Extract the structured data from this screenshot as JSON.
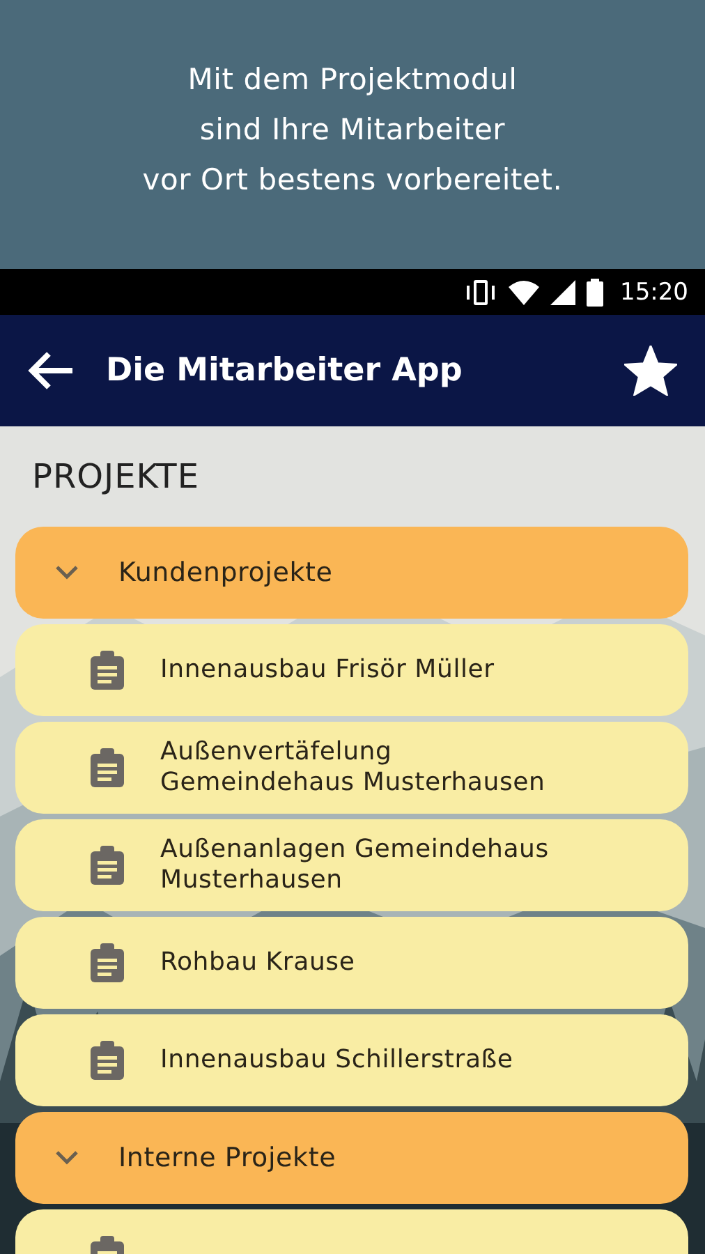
{
  "promo": {
    "lines": [
      "Mit dem Projektmodul",
      "sind Ihre Mitarbeiter",
      "vor Ort bestens vorbereitet."
    ]
  },
  "status_bar": {
    "time": "15:20"
  },
  "app_bar": {
    "title": "Die Mitarbeiter App",
    "favorite": true
  },
  "section_title": "PROJEKTE",
  "groups": [
    {
      "label": "Kundenprojekte",
      "expanded": true,
      "children": [
        {
          "kind": "project",
          "label": "Innenausbau Frisör Müller"
        },
        {
          "kind": "project",
          "label": "Außenvertäfelung Gemeindehaus Musterhausen"
        },
        {
          "kind": "project",
          "label": "Außenanlagen Gemeindehaus Musterhausen"
        },
        {
          "kind": "project",
          "label": "Rohbau Krause"
        },
        {
          "kind": "project",
          "label": "Innenausbau Schillerstraße"
        }
      ]
    },
    {
      "label": "Interne Projekte",
      "expanded": true,
      "children": [
        {
          "kind": "project"
        }
      ]
    }
  ]
}
